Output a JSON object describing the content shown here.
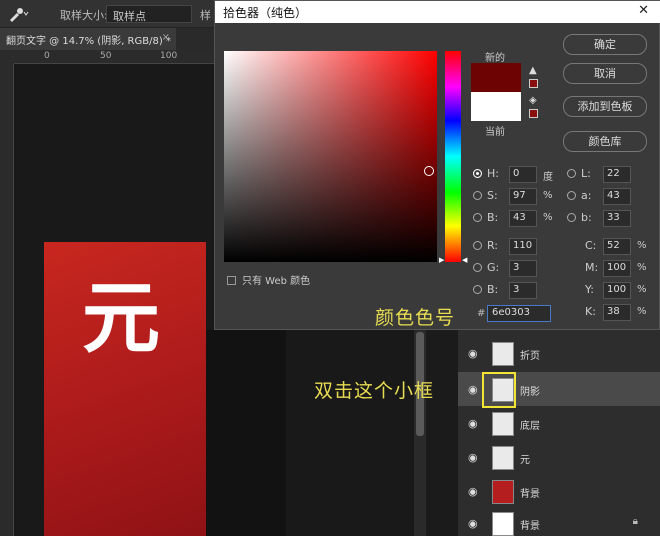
{
  "options_bar": {
    "sample_size_label": "取样大小:",
    "sample_size_value": "取样点",
    "next_label": "样"
  },
  "document_tab": {
    "title": "翻页文字 @ 14.7% (阴影, RGB/8) *",
    "close": "×"
  },
  "ruler": {
    "ticks": [
      "0",
      "50",
      "100"
    ]
  },
  "canvas": {
    "art_character": "元"
  },
  "annotations": {
    "double_click_hint": "双击这个小框",
    "color_code_hint": "颜色色号"
  },
  "layers": [
    {
      "name": "折页",
      "selected": false,
      "thumb": "doc"
    },
    {
      "name": "阴影",
      "selected": true,
      "thumb": "doc"
    },
    {
      "name": "底层",
      "selected": false,
      "thumb": "doc"
    },
    {
      "name": "元",
      "selected": false,
      "thumb": "doc"
    },
    {
      "name": "背景",
      "selected": false,
      "thumb": "red"
    },
    {
      "name": "背景",
      "selected": false,
      "thumb": "white",
      "locked": true
    }
  ],
  "picker": {
    "title": "拾色器（纯色）",
    "close": "✕",
    "new_label": "新的",
    "current_label": "当前",
    "new_color": "#6e0303",
    "current_color": "#ffffff",
    "buttons": {
      "ok": "确定",
      "cancel": "取消",
      "add_swatch": "添加到色板",
      "libraries": "颜色库"
    },
    "only_web": "只有 Web 颜色",
    "hsb": [
      {
        "label": "H:",
        "value": "0",
        "unit": "度",
        "selected": true
      },
      {
        "label": "S:",
        "value": "97",
        "unit": "%",
        "selected": false
      },
      {
        "label": "B:",
        "value": "43",
        "unit": "%",
        "selected": false
      }
    ],
    "rgb": [
      {
        "label": "R:",
        "value": "110"
      },
      {
        "label": "G:",
        "value": "3"
      },
      {
        "label": "B:",
        "value": "3"
      }
    ],
    "lab": [
      {
        "label": "L:",
        "value": "22"
      },
      {
        "label": "a:",
        "value": "43"
      },
      {
        "label": "b:",
        "value": "33"
      }
    ],
    "cmyk": [
      {
        "label": "C:",
        "value": "52",
        "unit": "%"
      },
      {
        "label": "M:",
        "value": "100",
        "unit": "%"
      },
      {
        "label": "Y:",
        "value": "100",
        "unit": "%"
      },
      {
        "label": "K:",
        "value": "38",
        "unit": "%"
      }
    ],
    "hex_label": "#",
    "hex": "6e0303"
  }
}
